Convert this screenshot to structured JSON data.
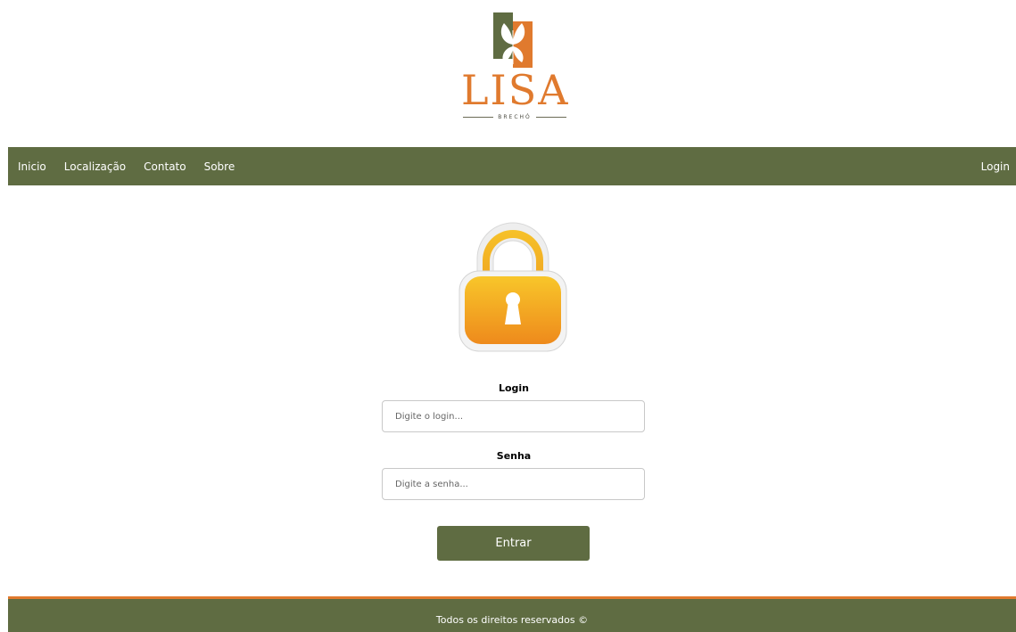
{
  "brand": {
    "name": "LISA",
    "tagline": "BRECHÓ",
    "colors": {
      "green": "#5f6c42",
      "orange": "#e07a2e"
    }
  },
  "nav": {
    "items": [
      {
        "label": "Inicio"
      },
      {
        "label": "Localização"
      },
      {
        "label": "Contato"
      },
      {
        "label": "Sobre"
      }
    ],
    "login_label": "Login"
  },
  "lock": {
    "icon": "padlock-icon"
  },
  "form": {
    "login_label": "Login",
    "login_placeholder": "Digite o login...",
    "login_value": "",
    "password_label": "Senha",
    "password_placeholder": "Digite a senha...",
    "password_value": "",
    "submit_label": "Entrar"
  },
  "footer": {
    "text": "Todos os direitos reservados ©"
  }
}
